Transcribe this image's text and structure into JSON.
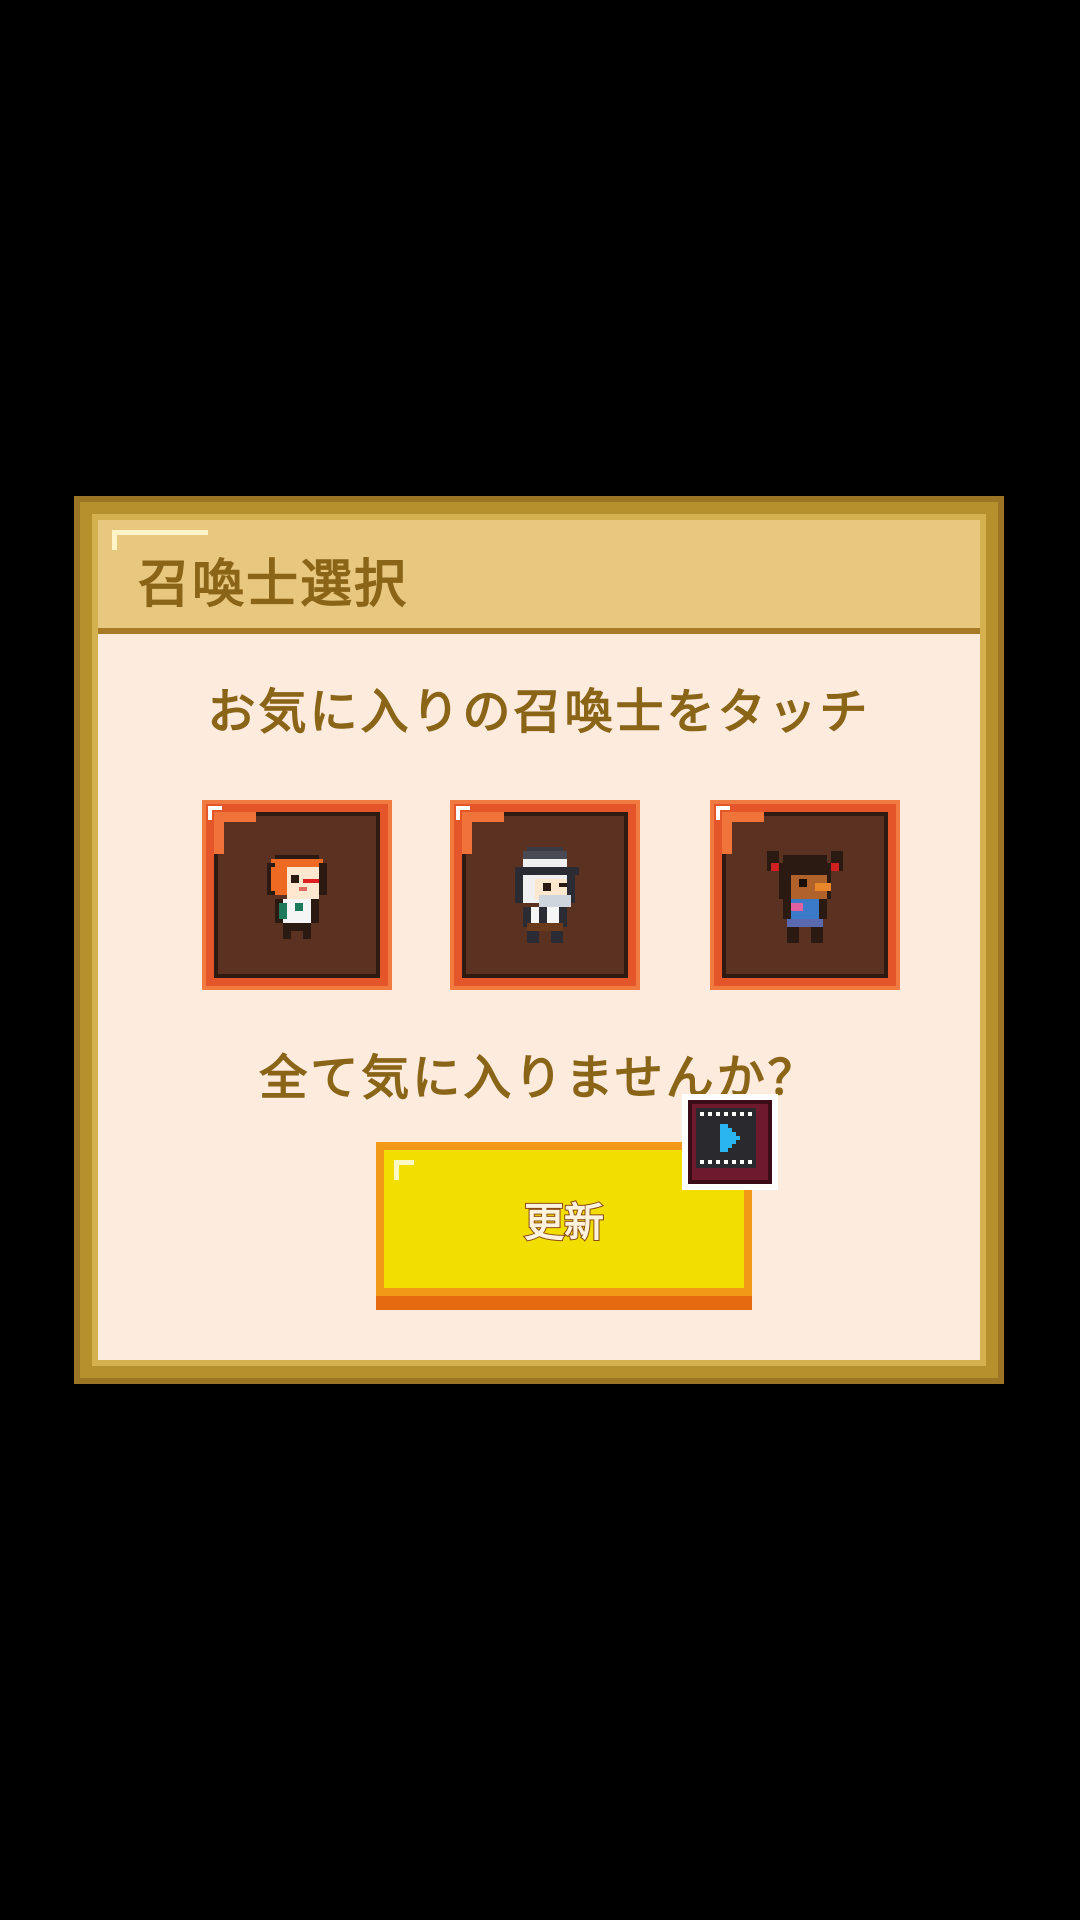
{
  "dialog": {
    "title": "召喚士選択",
    "prompt": "お気に入りの召喚士をタッチ",
    "question": "全て気に入りませんか？",
    "refresh_label": "更新",
    "refresh_icon": "video-ad-icon"
  },
  "summoners": [
    {
      "name": "summoner-orange-hair-girl",
      "icon": "orange-haired-girl-sprite"
    },
    {
      "name": "summoner-old-man-hat",
      "icon": "old-man-with-hat-sprite"
    },
    {
      "name": "summoner-pigtail-girl",
      "icon": "pigtail-girl-sprite"
    }
  ],
  "colors": {
    "frame": "#b7902e",
    "header": "#e8c77e",
    "panel": "#fdebde",
    "text": "#8a6417",
    "card": "#e4552a",
    "card_inner": "#5b3221",
    "button": "#f2de00",
    "button_shadow": "#e56a10"
  }
}
